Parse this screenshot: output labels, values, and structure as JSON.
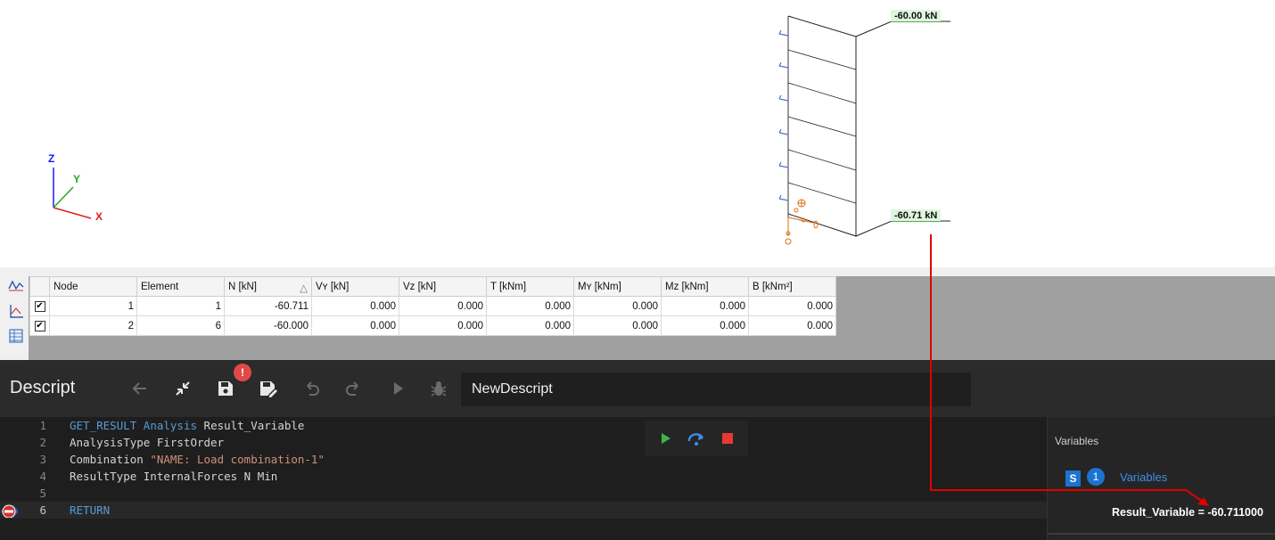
{
  "viewport": {
    "axes": {
      "x": "X",
      "y": "Y",
      "z": "Z"
    },
    "force_top": "-60.00 kN",
    "force_bottom": "-60.71 kN"
  },
  "results": {
    "columns": [
      "Node",
      "Element",
      "N [kN]",
      "Vʏ [kN]",
      "Vᴢ [kN]",
      "T [kNm]",
      "Mʏ [kNm]",
      "Mᴢ [kNm]",
      "B [kNm²]"
    ],
    "rows": [
      {
        "checked": true,
        "cells": [
          "1",
          "1",
          "-60.711",
          "0.000",
          "0.000",
          "0.000",
          "0.000",
          "0.000",
          "0.000"
        ]
      },
      {
        "checked": true,
        "cells": [
          "2",
          "6",
          "-60.000",
          "0.000",
          "0.000",
          "0.000",
          "0.000",
          "0.000",
          "0.000"
        ]
      }
    ],
    "sort_indicator": "△",
    "side_tools": [
      "diagram-icon",
      "result-graph-icon",
      "table-icon"
    ]
  },
  "editor": {
    "title": "Descript",
    "badge": "!",
    "script_name": "NewDescript",
    "toolbar_icons": [
      "back-arrow-icon",
      "collapse-icon",
      "save-icon",
      "save-as-icon",
      "undo-icon",
      "redo-icon",
      "play-icon",
      "debug-icon"
    ],
    "code": [
      {
        "n": "1",
        "parts": [
          [
            "kw",
            "GET_RESULT"
          ],
          [
            "",
            " "
          ],
          [
            "kw",
            "Analysis"
          ],
          [
            "",
            " Result_Variable"
          ]
        ]
      },
      {
        "n": "2",
        "parts": [
          [
            "",
            "AnalysisType FirstOrder"
          ]
        ]
      },
      {
        "n": "3",
        "parts": [
          [
            "",
            "Combination "
          ],
          [
            "str",
            "\"NAME: Load combination-1\""
          ]
        ]
      },
      {
        "n": "4",
        "parts": [
          [
            "",
            "ResultType InternalForces N Min"
          ]
        ]
      },
      {
        "n": "5",
        "parts": []
      },
      {
        "n": "6",
        "parts": [
          [
            "kw",
            "RETURN"
          ]
        ]
      }
    ],
    "active_line": "6"
  },
  "variables": {
    "title": "Variables",
    "section_label": "Variables",
    "count": "1",
    "type_icon": "S",
    "result": "Result_Variable = -60.711000"
  },
  "colors": {
    "highlight_arrow": "#e00000",
    "keyword": "#569cd6",
    "string": "#ce9178",
    "accent": "#1c73d0"
  }
}
